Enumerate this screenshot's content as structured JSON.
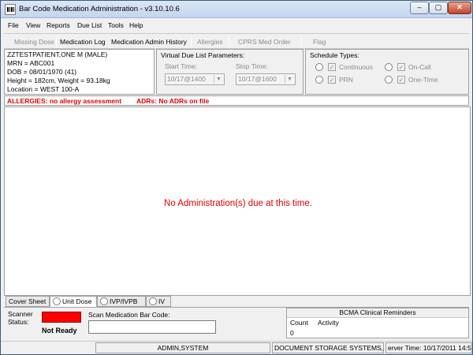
{
  "window": {
    "title": "Bar Code Medication Administration - v3.10.10.6",
    "min_label": "–",
    "max_label": "▢",
    "close_label": "✕"
  },
  "menu": [
    "File",
    "View",
    "Reports",
    "Due List",
    "Tools",
    "Help"
  ],
  "toolbar": {
    "missing_dose": "Missing Dose",
    "medication_log": "Medication Log",
    "med_admin_history": "Medication Admin History",
    "allergies": "Allergies",
    "cprs_med_order": "CPRS Med Order",
    "flag": "Flag"
  },
  "patient": {
    "name": "ZZTESTPATIENT,ONE M  (MALE)",
    "mrn": "MRN = ABC001",
    "dob": "DOB = 08/01/1970 (41)",
    "height_weight": "Height = 182cm, Weight = 93.18kg",
    "location": "Location = WEST 100-A"
  },
  "virtual_due_list": {
    "title": "Virtual Due List Parameters:",
    "start_label": "Start Time:",
    "start_value": "10/17@1400",
    "stop_label": "Stop Time:",
    "stop_value": "10/17@1600"
  },
  "schedule_types": {
    "title": "Schedule Types:",
    "continuous": "Continuous",
    "prn": "PRN",
    "on_call": "On-Call",
    "one_time": "One-Time",
    "check_mark": "✓"
  },
  "allergy": {
    "allergies_text": "ALLERGIES: no allergy assessment",
    "adrs_text": "ADRs: No ADRs on file"
  },
  "main": {
    "message": "No Administration(s) due at this time."
  },
  "tabs": {
    "cover_sheet": "Cover Sheet",
    "unit_dose": "Unit Dose",
    "ivp_ivpb": "IVP/IVPB",
    "iv": "IV"
  },
  "scanner": {
    "label_line1": "Scanner",
    "label_line2": "Status:",
    "status": "Not Ready",
    "status_color": "#ff0000",
    "scan_label": "Scan Medication Bar Code:"
  },
  "reminders": {
    "title": "BCMA Clinical Reminders",
    "col_count": "Count",
    "col_activity": "Activity",
    "count_value": "0"
  },
  "statusbar": {
    "user": "ADMIN,SYSTEM",
    "division": "DOCUMENT STORAGE SYSTEMS, INC",
    "server_time": "erver Time: 10/17/2011 14:5"
  },
  "colors": {
    "alert_red": "#e00000",
    "title_gradient_top": "#dbe7f5"
  }
}
